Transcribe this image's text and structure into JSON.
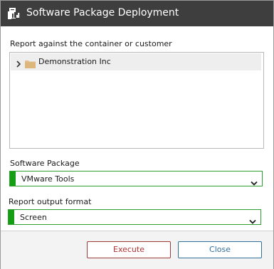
{
  "window": {
    "title": "Software Package Deployment",
    "icon": "report-deployment-icon"
  },
  "container": {
    "label": "Report against the container or customer",
    "tree": [
      {
        "label": "Demonstration Inc",
        "icon": "folder-icon",
        "expanded": false
      }
    ]
  },
  "software_package": {
    "label": "Software Package",
    "selected": "VMware Tools"
  },
  "output_format": {
    "label": "Report output format",
    "selected": "Screen"
  },
  "buttons": {
    "execute": "Execute",
    "close": "Close"
  },
  "colors": {
    "titlebar": "#3e3e3e",
    "required_accent": "#139e13",
    "execute_border": "#9c3a3a",
    "close_border": "#2f6f9e"
  }
}
